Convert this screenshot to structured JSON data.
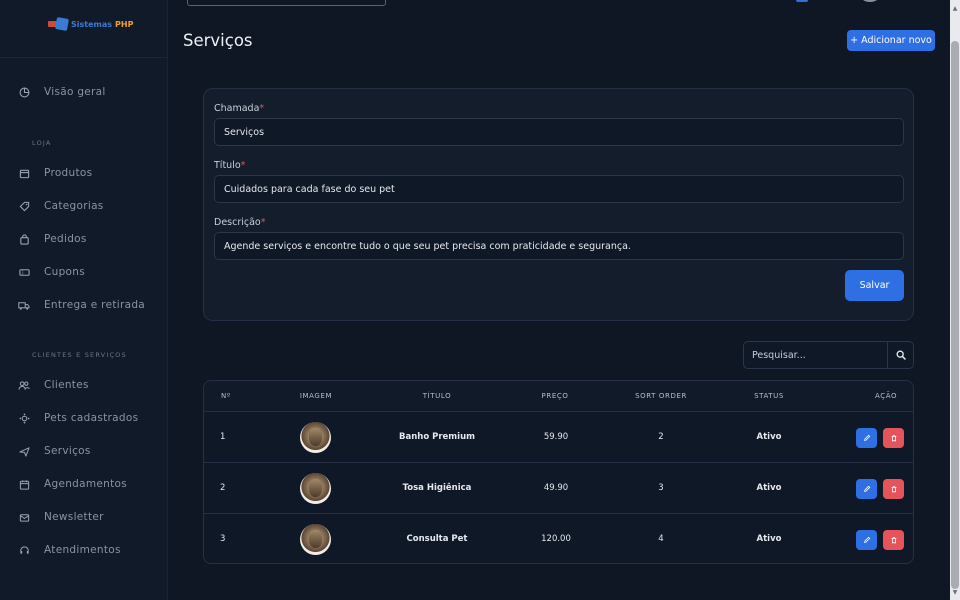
{
  "sidebar": {
    "logo": {
      "part1": "Sistemas",
      "part2": "PHP"
    },
    "overview": {
      "label": "Visão geral",
      "icon": "chart-pie-icon"
    },
    "section_loja": "LOJA",
    "loja_items": [
      {
        "label": "Produtos",
        "icon": "box-icon"
      },
      {
        "label": "Categorias",
        "icon": "tag-icon"
      },
      {
        "label": "Pedidos",
        "icon": "shopping-bag-icon"
      },
      {
        "label": "Cupons",
        "icon": "ticket-icon"
      },
      {
        "label": "Entrega e retirada",
        "icon": "truck-icon"
      }
    ],
    "section_clientes": "CLIENTES E SERVIÇOS",
    "clientes_items": [
      {
        "label": "Clientes",
        "icon": "users-icon"
      },
      {
        "label": "Pets cadastrados",
        "icon": "paw-icon"
      },
      {
        "label": "Serviços",
        "icon": "plane-icon"
      },
      {
        "label": "Agendamentos",
        "icon": "calendar-icon"
      },
      {
        "label": "Newsletter",
        "icon": "mail-icon"
      },
      {
        "label": "Atendimentos",
        "icon": "headset-icon"
      }
    ]
  },
  "header": {
    "title": "Serviços",
    "add_button": "+ Adicionar novo"
  },
  "form": {
    "chamada_label": "Chamada",
    "chamada_value": "Serviços",
    "titulo_label": "Título",
    "titulo_value": "Cuidados para cada fase do seu pet",
    "descricao_label": "Descrição",
    "descricao_value": "Agende serviços e encontre tudo o que seu pet precisa com praticidade e segurança.",
    "required_mark": "*",
    "save_button": "Salvar"
  },
  "search": {
    "placeholder": "Pesquisar..."
  },
  "table": {
    "headers": {
      "num": "Nº",
      "imagem": "IMAGEM",
      "titulo": "TÍTULO",
      "preco": "PREÇO",
      "sort": "SORT ORDER",
      "status": "STATUS",
      "acao": "AÇÃO"
    },
    "rows": [
      {
        "num": "1",
        "titulo": "Banho Premium",
        "preco": "59.90",
        "sort": "2",
        "status": "Ativo"
      },
      {
        "num": "2",
        "titulo": "Tosa Higiênica",
        "preco": "49.90",
        "sort": "3",
        "status": "Ativo"
      },
      {
        "num": "3",
        "titulo": "Consulta Pet",
        "preco": "120.00",
        "sort": "4",
        "status": "Ativo"
      }
    ]
  },
  "colors": {
    "accent": "#2f6fe4",
    "danger": "#e4545a",
    "background": "#0f1624"
  }
}
